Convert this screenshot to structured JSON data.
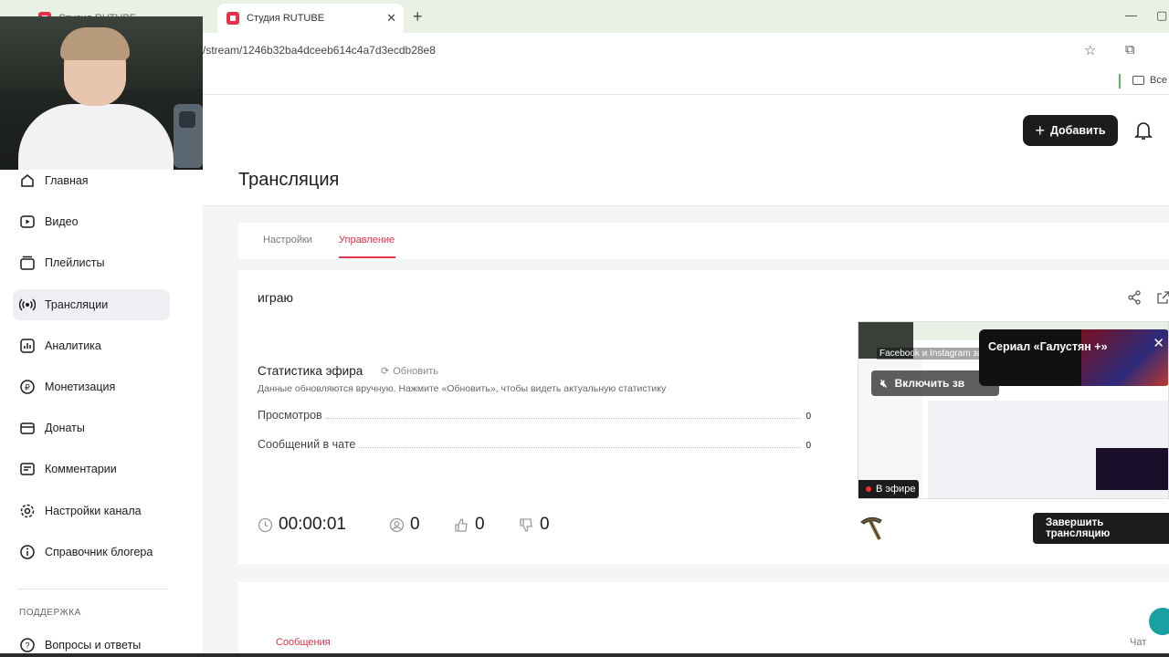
{
  "browser": {
    "tabs": [
      {
        "title": "Студия RUTUBE",
        "active": false
      },
      {
        "title": "Студия RUTUBE",
        "active": true
      }
    ],
    "url": "/stream/1246b32ba4dceeb614c4a7d3ecdb28e8",
    "bookmarks_all": "Все"
  },
  "sidebar": {
    "items": [
      {
        "label": "Главная",
        "icon": "home-icon"
      },
      {
        "label": "Видео",
        "icon": "video-icon"
      },
      {
        "label": "Плейлисты",
        "icon": "playlist-icon"
      },
      {
        "label": "Трансляции",
        "icon": "broadcast-icon",
        "active": true
      },
      {
        "label": "Аналитика",
        "icon": "analytics-icon"
      },
      {
        "label": "Монетизация",
        "icon": "monetization-icon"
      },
      {
        "label": "Донаты",
        "icon": "donate-icon"
      },
      {
        "label": "Комментарии",
        "icon": "comments-icon"
      },
      {
        "label": "Настройки канала",
        "icon": "gear-icon"
      },
      {
        "label": "Справочник блогера",
        "icon": "info-icon"
      }
    ],
    "support_heading": "ПОДДЕРЖКА",
    "support_items": [
      {
        "label": "Вопросы и ответы",
        "icon": "help-icon"
      }
    ]
  },
  "header": {
    "add_label": "Добавить"
  },
  "page": {
    "title": "Трансляция",
    "tabs": [
      {
        "label": "Настройки",
        "active": false
      },
      {
        "label": "Управление",
        "active": true
      }
    ]
  },
  "stream": {
    "name": "играю",
    "stats_title": "Статистика эфира",
    "refresh_label": "Обновить",
    "stats_note": "Данные обновляются вручную. Нажмите «Обновить», чтобы видеть актуальную статистику",
    "stats": [
      {
        "label": "Просмотров",
        "value": "0"
      },
      {
        "label": "Сообщений в чате",
        "value": "0"
      }
    ],
    "timer": "00:00:01",
    "viewers": "0",
    "likes": "0",
    "dislikes": "0",
    "end_label": "Завершить трансляцию"
  },
  "preview": {
    "sound_label": "Включить зв",
    "live_label": "В эфире",
    "ad_title": "Сериал «Галустян +»",
    "overlay_text": "Facebook и Instagram за"
  },
  "chat": {
    "tab_messages": "Сообщения",
    "tab_chat": "Чат"
  },
  "colors": {
    "accent": "#e8304a",
    "dark": "#1c1c1e"
  }
}
